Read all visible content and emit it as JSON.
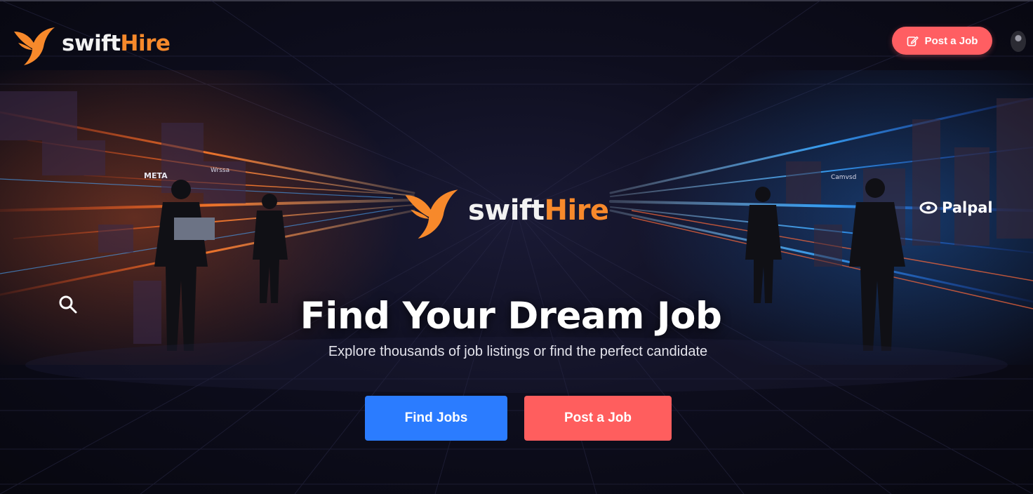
{
  "brand": {
    "name_part1": "swift",
    "name_part2": "Hire"
  },
  "nav": {
    "post_job_label": "Post a Job"
  },
  "hero": {
    "title": "Find Your Dream Job",
    "subtitle": "Explore thousands of job listings or find the perfect candidate",
    "find_jobs_label": "Find Jobs",
    "post_job_label": "Post a Job"
  },
  "illustration": {
    "meta_label": "META",
    "left_tag": "Wrssa",
    "right_tag": "Camvsd",
    "palpal_label": "Palpal"
  },
  "colors": {
    "brand_orange": "#f7892b",
    "post_button": "#ff5e62",
    "find_button": "#2b7cff",
    "background": "#0b0b17"
  },
  "icons": [
    "swift-bird-logo",
    "edit-icon",
    "avatar",
    "search-icon",
    "palpal-logo"
  ]
}
